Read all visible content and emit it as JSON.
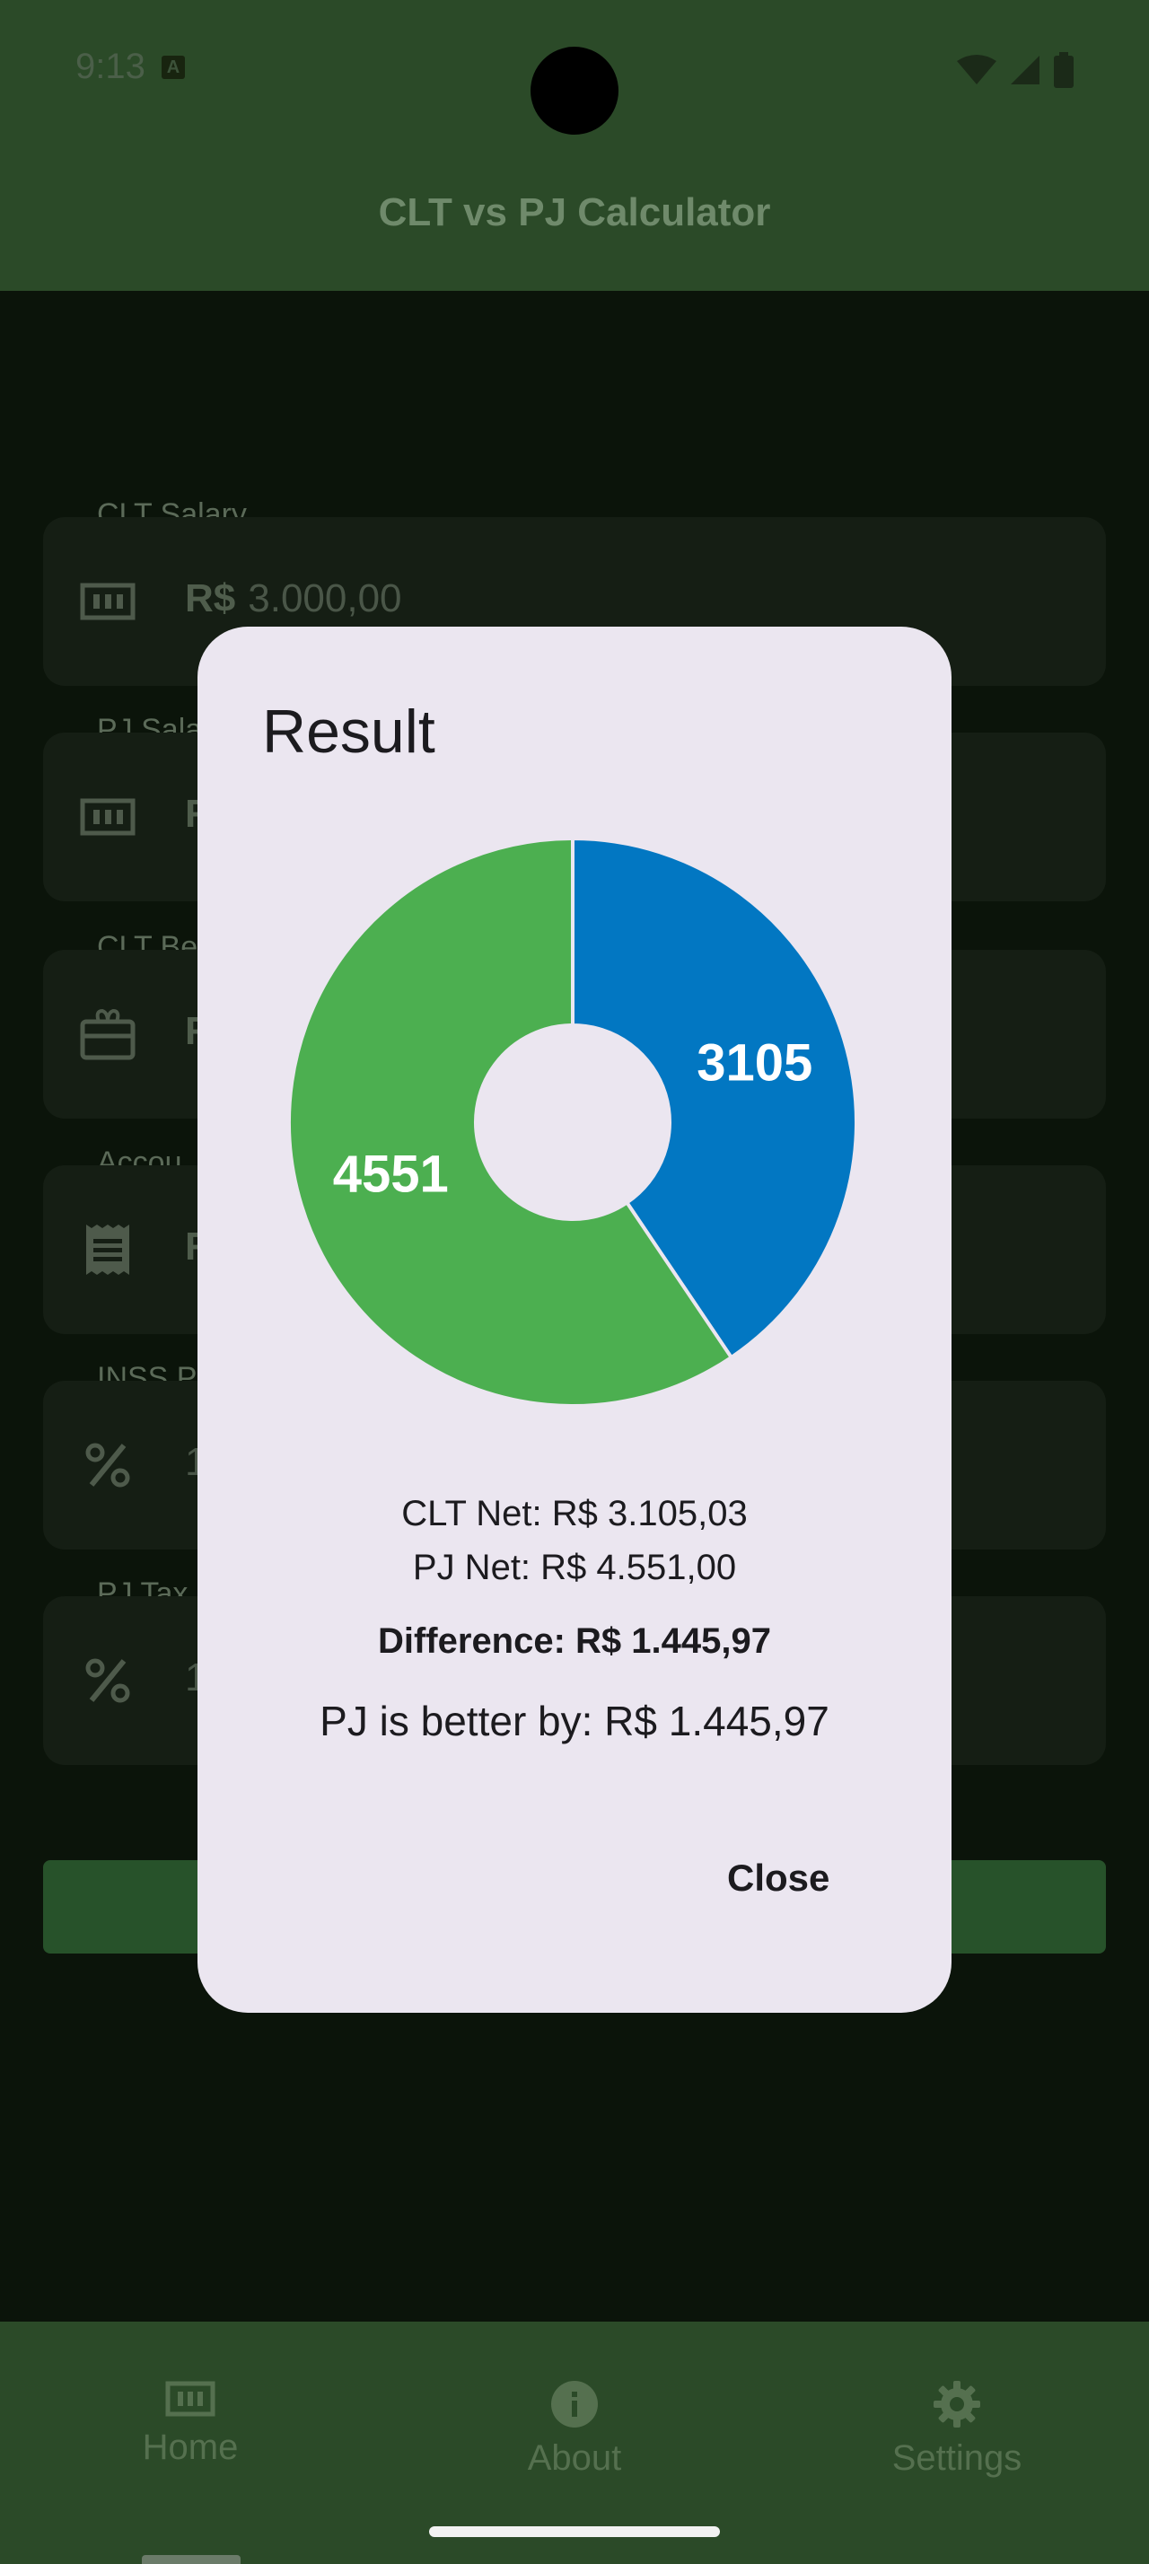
{
  "status": {
    "time": "9:13",
    "notif_letter": "A"
  },
  "app": {
    "title": "CLT vs PJ Calculator"
  },
  "form": {
    "clt_salary_label": "CLT Salary",
    "currency_prefix": "R$",
    "clt_salary_value": "3.000,00",
    "pj_salary_label": "PJ Sala",
    "clt_benefits_label": "CLT Be",
    "accountant_label": "Accou",
    "inss_label": "INSS P",
    "pj_tax_label": "PJ Tax",
    "clipped_prefix": "R",
    "clipped_digit": "1"
  },
  "dialog": {
    "title": "Result",
    "clt_net": "CLT Net: R$  3.105,03",
    "pj_net": "PJ Net: R$  4.551,00",
    "difference": "Difference: R$  1.445,97",
    "verdict": "PJ is better by: R$ 1.445,97",
    "close_label": "Close"
  },
  "chart_data": {
    "type": "pie",
    "donut": true,
    "categories": [
      "CLT Net",
      "PJ Net"
    ],
    "values": [
      3105,
      4551
    ],
    "labels": [
      "3105",
      "4551"
    ],
    "colors": [
      "#0277c2",
      "#4caf50"
    ]
  },
  "nav": {
    "items": [
      {
        "label": "Home",
        "icon": "money-icon"
      },
      {
        "label": "About",
        "icon": "info-icon"
      },
      {
        "label": "Settings",
        "icon": "gear-icon"
      }
    ]
  }
}
